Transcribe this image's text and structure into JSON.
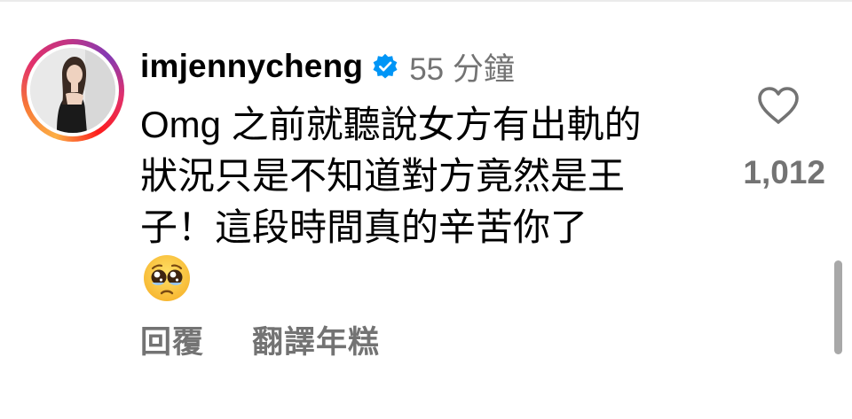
{
  "comment": {
    "username": "imjennycheng",
    "verified": true,
    "time": "55 分鐘",
    "text": "Omg 之前就聽說女方有出軌的\n狀況只是不知道對方竟然是王\n子！這段時間真的辛苦你了",
    "emoji_icon": "pleading-face-icon",
    "like_count": "1,012",
    "reply_label": "回覆",
    "translate_label": "翻譯年糕"
  },
  "colors": {
    "text": "#000000",
    "secondary": "#737373",
    "verified_badge": "#0095f6",
    "story_ring": [
      "#fcaf45",
      "#f77737",
      "#e1306c",
      "#c13584",
      "#833ab4"
    ],
    "scrollbar": "#a8a8a8"
  },
  "icons": {
    "verified": "verified-badge-icon",
    "like": "heart-outline-icon"
  }
}
